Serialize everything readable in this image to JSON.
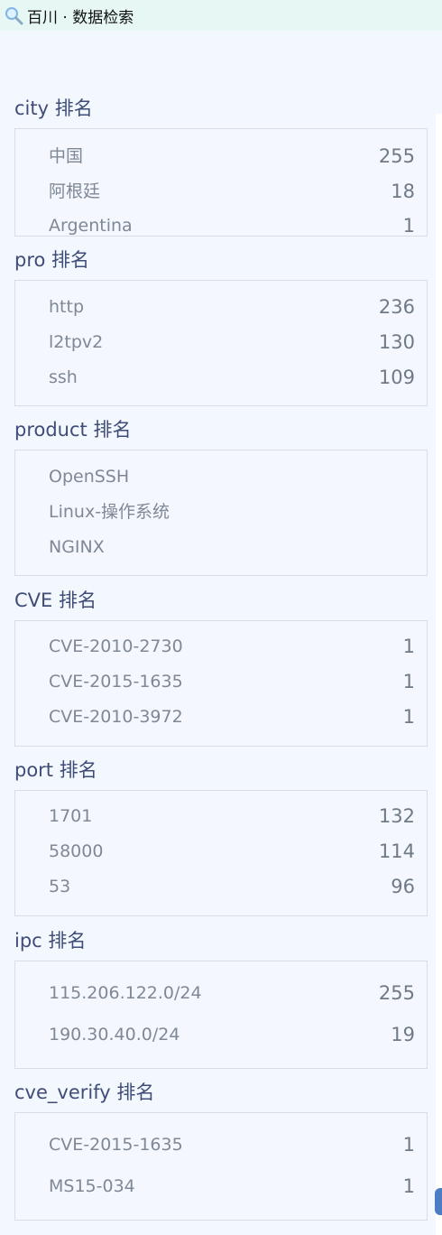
{
  "app": {
    "title": "百川 · 数据检索",
    "icon": "search-icon"
  },
  "sections": {
    "city": {
      "title": "city 排名",
      "rows": [
        {
          "label": "中国",
          "value": "255"
        },
        {
          "label": "阿根廷",
          "value": "18"
        },
        {
          "label": "Argentina",
          "value": "1"
        }
      ]
    },
    "pro": {
      "title": "pro 排名",
      "rows": [
        {
          "label": "http",
          "value": "236"
        },
        {
          "label": "l2tpv2",
          "value": "130"
        },
        {
          "label": "ssh",
          "value": "109"
        }
      ]
    },
    "product": {
      "title": "product 排名",
      "rows": [
        {
          "label": "OpenSSH",
          "value": ""
        },
        {
          "label": "Linux-操作系统",
          "value": ""
        },
        {
          "label": "NGINX",
          "value": ""
        }
      ]
    },
    "cve": {
      "title": "CVE 排名",
      "rows": [
        {
          "label": "CVE-2010-2730",
          "value": "1"
        },
        {
          "label": "CVE-2015-1635",
          "value": "1"
        },
        {
          "label": "CVE-2010-3972",
          "value": "1"
        }
      ]
    },
    "port": {
      "title": "port 排名",
      "rows": [
        {
          "label": "1701",
          "value": "132"
        },
        {
          "label": "58000",
          "value": "114"
        },
        {
          "label": "53",
          "value": "96"
        }
      ]
    },
    "ipc": {
      "title": "ipc 排名",
      "rows": [
        {
          "label": "115.206.122.0/24",
          "value": "255"
        },
        {
          "label": "190.30.40.0/24",
          "value": "19"
        }
      ]
    },
    "cve_verify": {
      "title": "cve_verify 排名",
      "rows": [
        {
          "label": "CVE-2015-1635",
          "value": "1"
        },
        {
          "label": "MS15-034",
          "value": "1"
        }
      ]
    }
  },
  "colors": {
    "titlebar_bg": "#e6f7f4",
    "page_bg": "#f3f7fe",
    "section_title": "#3f4d78",
    "row_text": "#7f8894",
    "scroll_handle": "#4a7dc4"
  }
}
